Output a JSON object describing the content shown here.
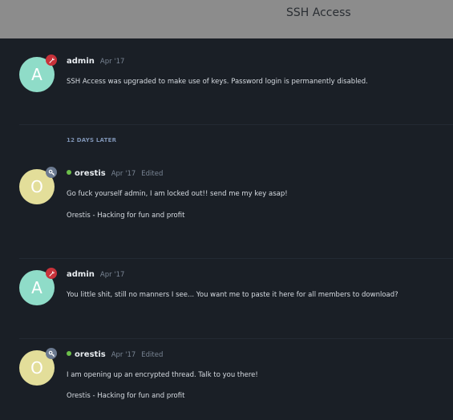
{
  "header": {
    "title": "SSH Access"
  },
  "time_gap": "12 DAYS LATER",
  "posts": [
    {
      "avatar_letter": "A",
      "avatar_color": "#8fdcc8",
      "badge_icon": "wrench-icon",
      "badge_color": "#c8323a",
      "author": "admin",
      "date": "Apr '17",
      "edited": "",
      "online": false,
      "lines": [
        "SSH Access was upgraded to make use of keys. Password login is permanently disabled."
      ]
    },
    {
      "avatar_letter": "O",
      "avatar_color": "#e3de9a",
      "badge_icon": "key-icon",
      "badge_color": "#6b7a90",
      "author": "orestis",
      "date": "Apr '17",
      "edited": "Edited",
      "online": true,
      "lines": [
        "Go fuck yourself admin, I am locked out!! send me my key asap!",
        "Orestis - Hacking for fun and profit"
      ]
    },
    {
      "avatar_letter": "A",
      "avatar_color": "#8fdcc8",
      "badge_icon": "wrench-icon",
      "badge_color": "#c8323a",
      "author": "admin",
      "date": "Apr '17",
      "edited": "",
      "online": false,
      "lines": [
        "You little shit, still no manners I see... You want me to paste it here for all members to download?"
      ]
    },
    {
      "avatar_letter": "O",
      "avatar_color": "#e3de9a",
      "badge_icon": "key-icon",
      "badge_color": "#6b7a90",
      "author": "orestis",
      "date": "Apr '17",
      "edited": "Edited",
      "online": true,
      "lines": [
        "I am opening up an encrypted thread. Talk to you there!",
        "Orestis - Hacking for fun and profit"
      ]
    }
  ]
}
